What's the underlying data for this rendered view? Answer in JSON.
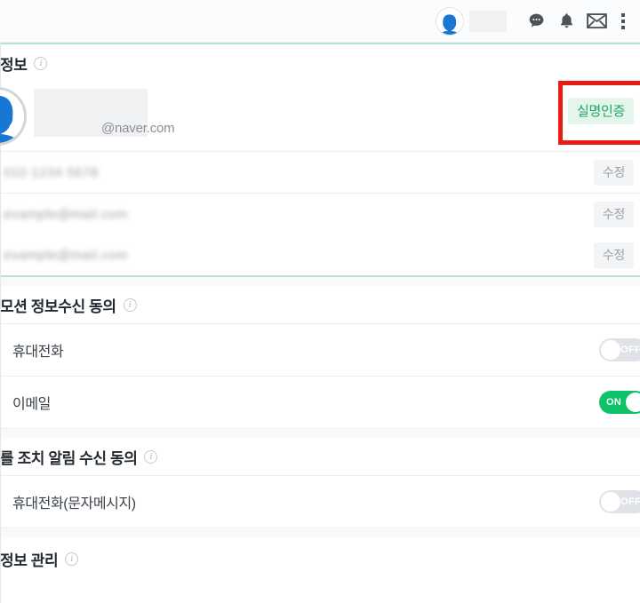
{
  "header": {
    "avatar_icon": "person-avatar-icon",
    "name_redacted": true,
    "icons": [
      {
        "name": "chat-bubble-icon",
        "label": ""
      },
      {
        "name": "bell-notification-icon",
        "label": ""
      },
      {
        "name": "mail-envelope-icon",
        "label": ""
      },
      {
        "name": "kebab-menu-icon",
        "label": ""
      }
    ]
  },
  "sections": {
    "basic_info": {
      "title": "정보",
      "info_tooltip": "i",
      "profile": {
        "email_suffix": "@naver.com",
        "redacted": true
      },
      "verify_badge": "실명인증",
      "rows": [
        {
          "value_redacted": true,
          "edit_label": "수정"
        },
        {
          "value_redacted": true,
          "edit_label": "수정"
        },
        {
          "value_redacted": true,
          "edit_label": "수정"
        }
      ],
      "edit_label": "수정"
    },
    "promotion_consent": {
      "title": "모션 정보수신 동의",
      "info_tooltip": "i",
      "items": [
        {
          "label": "휴대전화",
          "state": "OFF",
          "on": false
        },
        {
          "label": "이메일",
          "state": "ON",
          "on": true
        }
      ]
    },
    "restriction_notice_consent": {
      "title": "를 조치 알림 수신 동의",
      "info_tooltip": "i",
      "items": [
        {
          "label": "휴대전화(문자메시지)",
          "state": "OFF",
          "on": false
        }
      ]
    },
    "info_management": {
      "title": "정보 관리",
      "info_tooltip": "i"
    }
  },
  "annotation": {
    "type": "rectangle-highlight",
    "color": "#e81b15",
    "target": "실명인증"
  },
  "colors": {
    "accent_green": "#0dc268",
    "badge_bg": "#e4f5ec",
    "badge_text": "#1ea666",
    "mint_rule": "#b7e4cf",
    "annotation_red": "#e81b15"
  }
}
